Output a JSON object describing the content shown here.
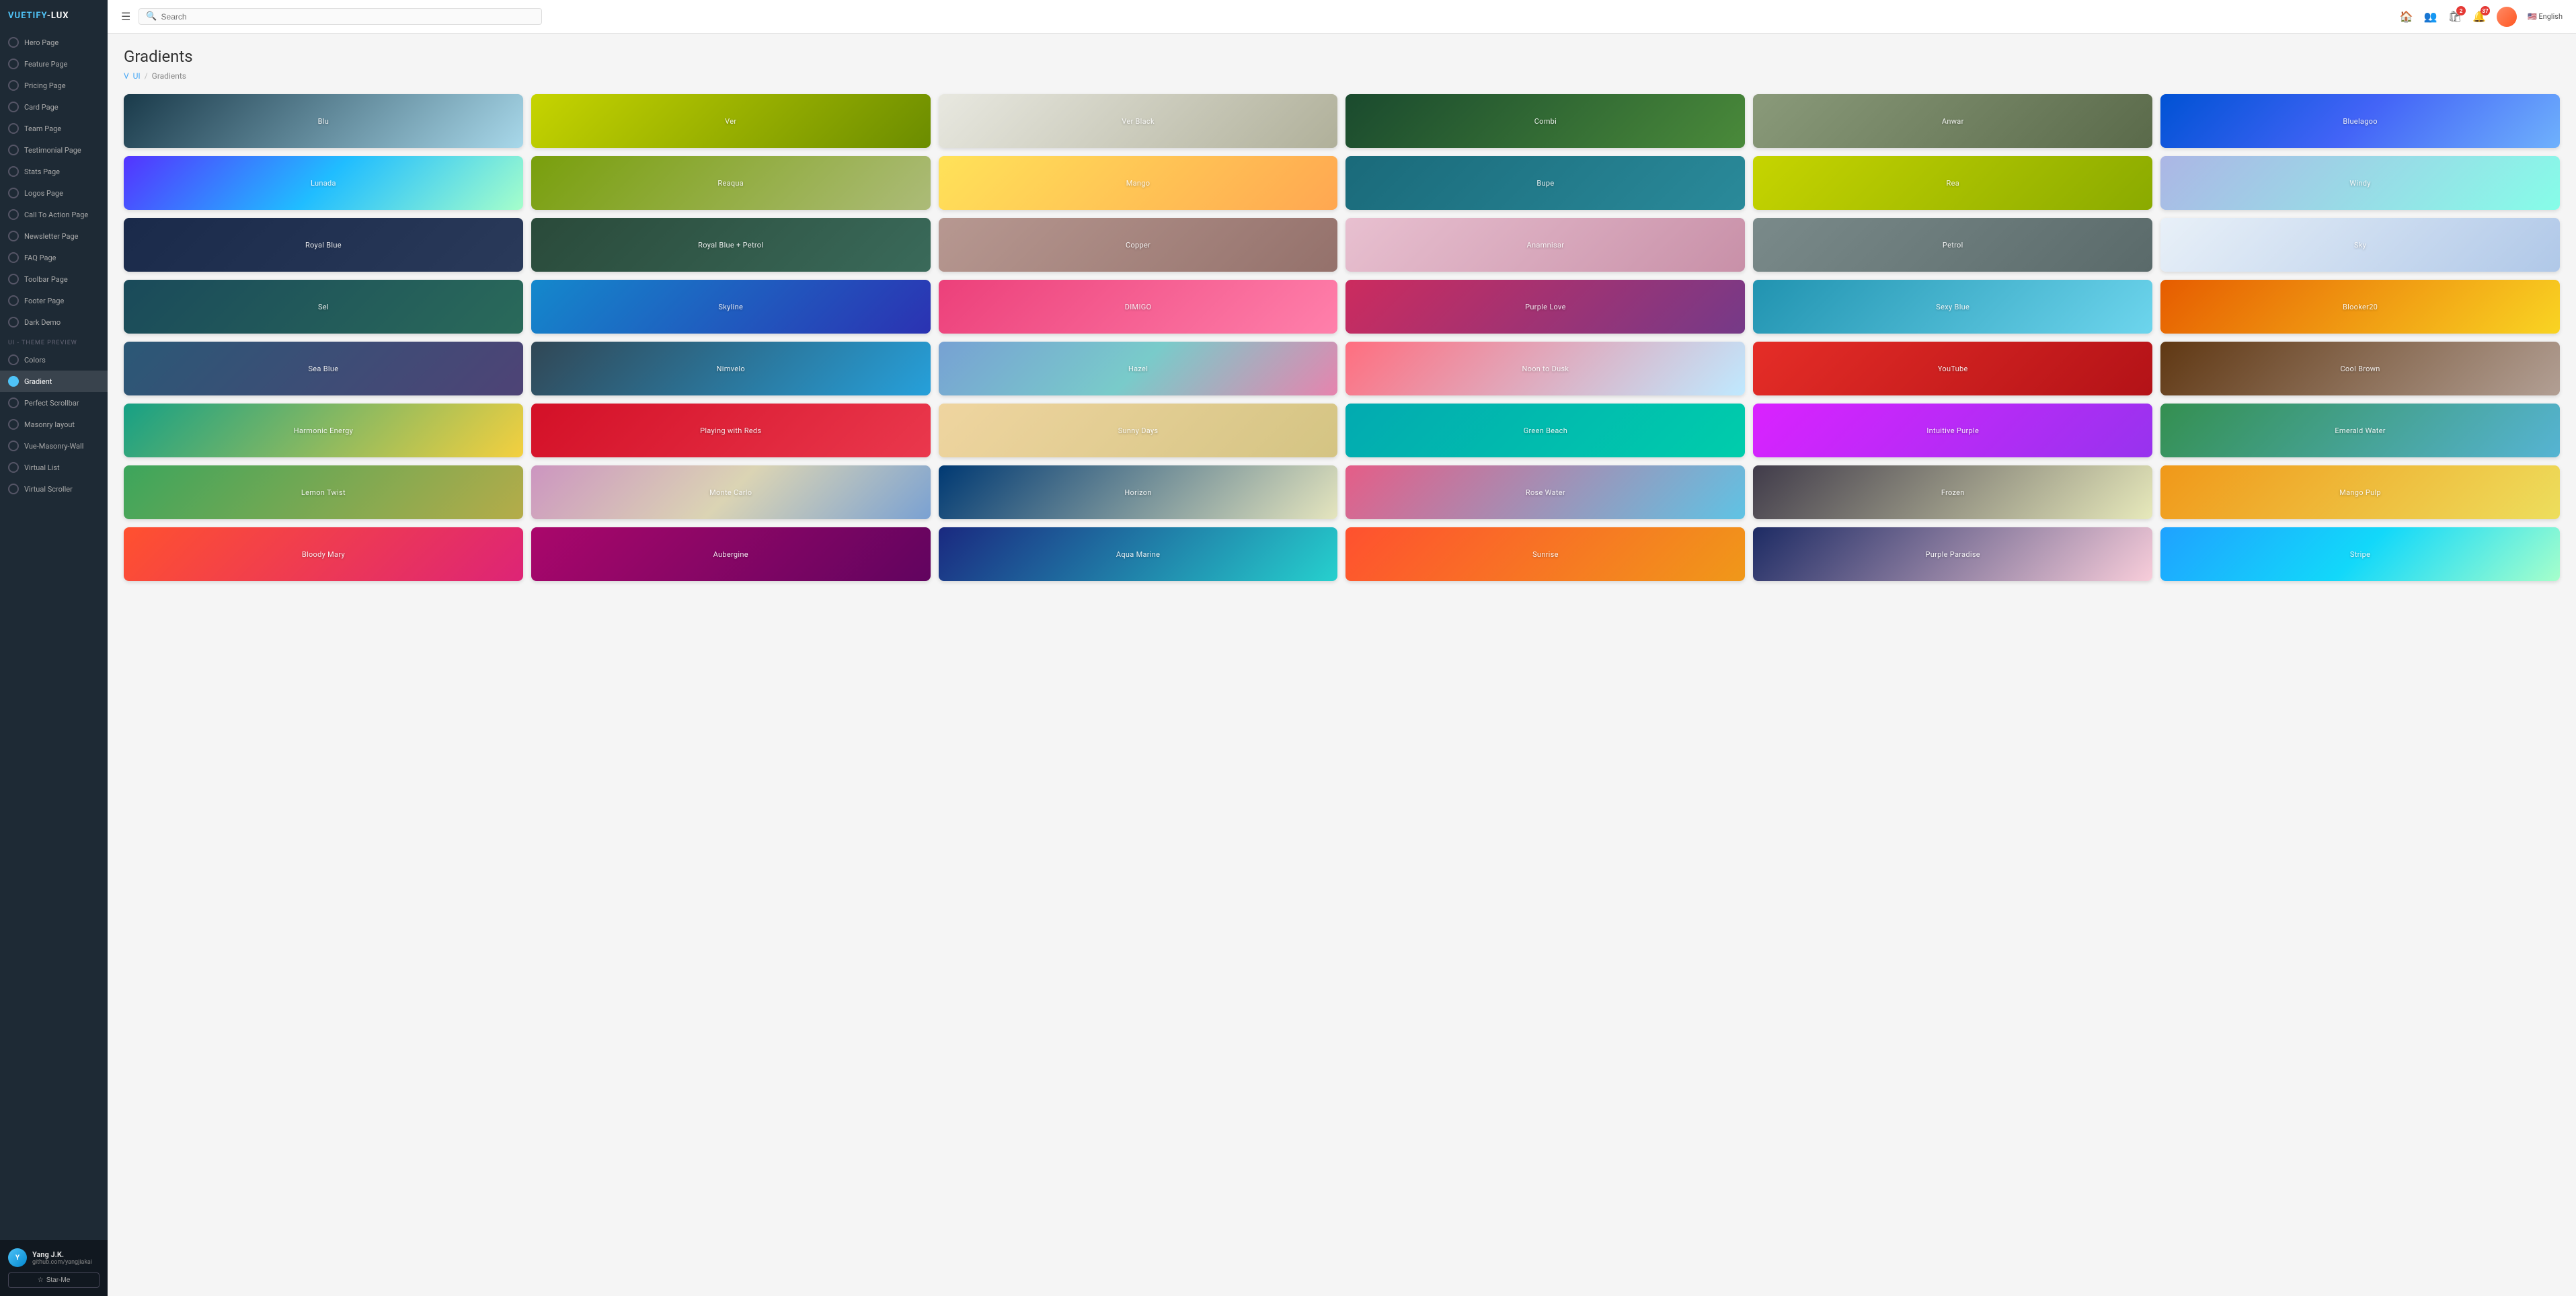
{
  "app": {
    "title": "VUETIFY-LUX"
  },
  "header": {
    "menu_icon": "☰",
    "search_placeholder": "Search",
    "lang": "🇺🇸 English",
    "notifications_count": "37",
    "cart_count": "2"
  },
  "breadcrumb": {
    "icon": "V",
    "parent": "UI",
    "current": "Gradients"
  },
  "page": {
    "title": "Gradients"
  },
  "sidebar": {
    "items": [
      {
        "label": "Hero Page"
      },
      {
        "label": "Feature Page"
      },
      {
        "label": "Pricing Page"
      },
      {
        "label": "Card Page"
      },
      {
        "label": "Team Page"
      },
      {
        "label": "Testimonial Page"
      },
      {
        "label": "Stats Page"
      },
      {
        "label": "Logos Page"
      },
      {
        "label": "Call To Action Page"
      },
      {
        "label": "Newsletter Page"
      },
      {
        "label": "FAQ Page"
      },
      {
        "label": "Toolbar Page"
      },
      {
        "label": "Footer Page"
      },
      {
        "label": "Dark Demo"
      }
    ],
    "section_label": "UI - THEME PREVIEW",
    "theme_items": [
      {
        "label": "Colors"
      },
      {
        "label": "Gradient",
        "active": true
      },
      {
        "label": "Perfect Scrollbar"
      },
      {
        "label": "Masonry layout"
      },
      {
        "label": "Vue-Masonry-Wall"
      },
      {
        "label": "Virtual List"
      },
      {
        "label": "Virtual Scroller"
      }
    ],
    "user": {
      "name": "Yang J.K.",
      "github": "github.com/yangjiakai"
    },
    "star_label": "Star-Me"
  },
  "gradients": [
    {
      "name": "Blu",
      "gradient": "linear-gradient(135deg, #1a3a4a 0%, #a8d8ea 100%)"
    },
    {
      "name": "Ver",
      "gradient": "linear-gradient(135deg, #c6d400 0%, #6b8c00 100%)"
    },
    {
      "name": "Ver Black",
      "gradient": "linear-gradient(135deg, #e8e8e0 0%, #b0b09a 100%)"
    },
    {
      "name": "Combi",
      "gradient": "linear-gradient(135deg, #1a4a2e 0%, #4a8a3a 100%)"
    },
    {
      "name": "Anwar",
      "gradient": "linear-gradient(135deg, #8a9a7a 0%, #5a6a4a 100%)"
    },
    {
      "name": "Bluelagoo",
      "gradient": "linear-gradient(135deg, #0052d4 0%, #4364f7 50%, #6fb1fc 100%)"
    },
    {
      "name": "Lunada",
      "gradient": "linear-gradient(135deg, #5433ff 0%, #20bdff 50%, #a5fecb 100%)"
    },
    {
      "name": "Reaqua",
      "gradient": "linear-gradient(135deg, #799f0c 0%, #acbb78 100%)"
    },
    {
      "name": "Mango",
      "gradient": "linear-gradient(135deg, #ffe259 0%, #ffa751 100%)"
    },
    {
      "name": "Bupe",
      "gradient": "linear-gradient(135deg, #1a6a7a 0%, #2a8a9a 100%)"
    },
    {
      "name": "Rea",
      "gradient": "linear-gradient(135deg, #c6d400 0%, #8aaa00 100%)"
    },
    {
      "name": "Windy",
      "gradient": "linear-gradient(135deg, #acb6e5 0%, #86fde8 100%)"
    },
    {
      "name": "Royal Blue",
      "gradient": "linear-gradient(135deg, #1a2a4a 0%, #2a3a5a 100%)"
    },
    {
      "name": "Royal Blue + Petrol",
      "gradient": "linear-gradient(135deg, #2a4a3a 0%, #3a6a5a 100%)"
    },
    {
      "name": "Copper",
      "gradient": "linear-gradient(135deg, #b79891 0%, #94716b 100%)"
    },
    {
      "name": "Anamnisar",
      "gradient": "linear-gradient(135deg, #e8c0d0 0%, #c890a8 100%)"
    },
    {
      "name": "Petrol",
      "gradient": "linear-gradient(135deg, #7a8a8a 0%, #5a6a6a 100%)"
    },
    {
      "name": "Sky",
      "gradient": "linear-gradient(135deg, #e8f0f8 0%, #b0c8e8 100%)"
    },
    {
      "name": "Sel",
      "gradient": "linear-gradient(135deg, #1a4a5a 0%, #2a6a5a 100%)"
    },
    {
      "name": "Skyline",
      "gradient": "linear-gradient(135deg, #1488cc 0%, #2b32b2 100%)"
    },
    {
      "name": "DIMIGO",
      "gradient": "linear-gradient(135deg, #ec407a 0%, #ff80ab 100%)"
    },
    {
      "name": "Purple Love",
      "gradient": "linear-gradient(135deg, #cc2b5e 0%, #753a88 100%)"
    },
    {
      "name": "Sexy Blue",
      "gradient": "linear-gradient(135deg, #2193b0 0%, #6dd5ed 100%)"
    },
    {
      "name": "Blooker20",
      "gradient": "linear-gradient(135deg, #e65c00 0%, #f9d423 100%)"
    },
    {
      "name": "Sea Blue",
      "gradient": "linear-gradient(135deg, #2b5876 0%, #4e4376 100%)"
    },
    {
      "name": "Nimvelo",
      "gradient": "linear-gradient(135deg, #314755 0%, #26a0da 100%)"
    },
    {
      "name": "Hazel",
      "gradient": "linear-gradient(135deg, #77a1d3 0%, #79cbca 50%, #e684ae 100%)"
    },
    {
      "name": "Noon to Dusk",
      "gradient": "linear-gradient(135deg, #ff6e7f 0%, #bfe9ff 100%)"
    },
    {
      "name": "YouTube",
      "gradient": "linear-gradient(135deg, #e52d27 0%, #b31217 100%)"
    },
    {
      "name": "Cool Brown",
      "gradient": "linear-gradient(135deg, #603813 0%, #b29f94 100%)"
    },
    {
      "name": "Harmonic Energy",
      "gradient": "linear-gradient(135deg, #16a085 0%, #f4d03f 100%)"
    },
    {
      "name": "Playing with Reds",
      "gradient": "linear-gradient(135deg, #d31027 0%, #ea384d 100%)"
    },
    {
      "name": "Sunny Days",
      "gradient": "linear-gradient(135deg, #efd5a0 0%, #d4c483 100%)"
    },
    {
      "name": "Green Beach",
      "gradient": "linear-gradient(135deg, #02aab0 0%, #00cdac 100%)"
    },
    {
      "name": "Intuitive Purple",
      "gradient": "linear-gradient(135deg, #da22ff 0%, #9733ee 100%)"
    },
    {
      "name": "Emerald Water",
      "gradient": "linear-gradient(135deg, #348f50 0%, #56b4d3 100%)"
    },
    {
      "name": "Lemon Twist",
      "gradient": "linear-gradient(135deg, #3ca55c 0%, #b5ac49 100%)"
    },
    {
      "name": "Monte Carlo",
      "gradient": "linear-gradient(135deg, #cc95c0 0%, #dbd4b4 50%, #7aa1d2 100%)"
    },
    {
      "name": "Horizon",
      "gradient": "linear-gradient(135deg, #003973 0%, #e5e5be 100%)"
    },
    {
      "name": "Rose Water",
      "gradient": "linear-gradient(135deg, #e55d87 0%, #5fc3e4 100%)"
    },
    {
      "name": "Frozen",
      "gradient": "linear-gradient(135deg, #403b4a 0%, #e7e9bb 100%)"
    },
    {
      "name": "Mango Pulp",
      "gradient": "linear-gradient(135deg, #f09819 0%, #edde5d 100%)"
    },
    {
      "name": "Bloody Mary",
      "gradient": "linear-gradient(135deg, #ff512f 0%, #dd2476 100%)"
    },
    {
      "name": "Aubergine",
      "gradient": "linear-gradient(135deg, #aa076b 0%, #61045f 100%)"
    },
    {
      "name": "Aqua Marine",
      "gradient": "linear-gradient(135deg, #1a2980 0%, #26d0ce 100%)"
    },
    {
      "name": "Sunrise",
      "gradient": "linear-gradient(135deg, #ff512f 0%, #f09819 100%)"
    },
    {
      "name": "Purple Paradise",
      "gradient": "linear-gradient(135deg, #1d2b64 0%, #f8cdda 100%)"
    },
    {
      "name": "Stripe",
      "gradient": "linear-gradient(135deg, #1fa2ff 0%, #12d8fa 50%, #a6ffcb 100%)"
    }
  ]
}
